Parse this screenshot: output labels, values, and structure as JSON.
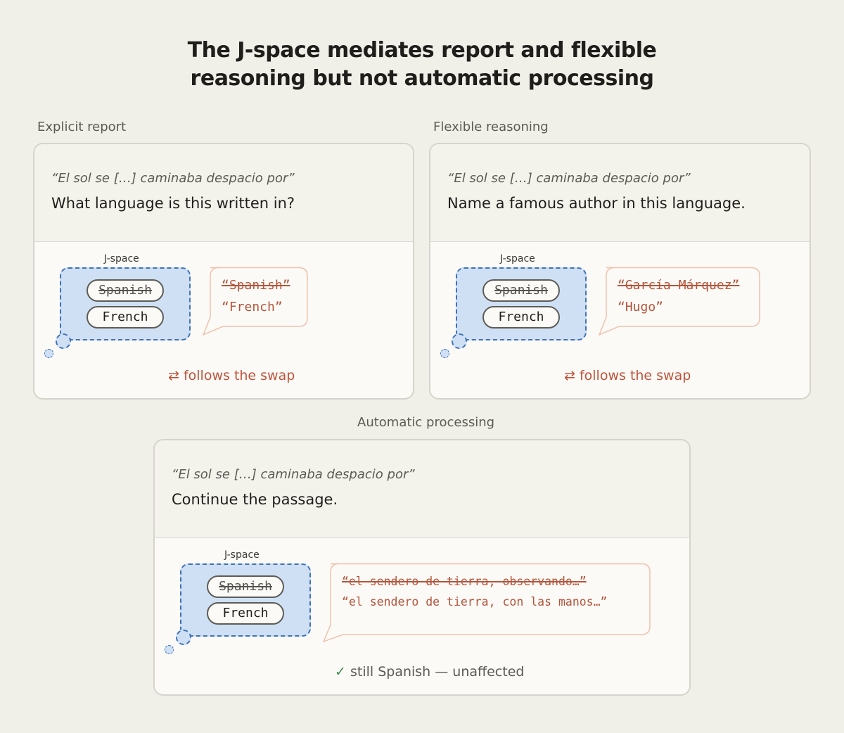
{
  "title": {
    "line1": "The J-space mediates report and flexible",
    "line2": "reasoning but not automatic processing"
  },
  "colors": {
    "background": "#f0efe8",
    "jspace_fill": "#cfe0f4",
    "jspace_border": "#3f72b8",
    "output_text": "#b5543a",
    "check": "#3f8a4a"
  },
  "panels": [
    {
      "label": "Explicit report",
      "quote": "“El sol se […] caminaba despacio por”",
      "question": "What language is this written in?",
      "jspace_label": "J-space",
      "pill_struck": "Spanish",
      "pill_active": "French",
      "output_struck": "“Spanish”",
      "output_active": "“French”",
      "note_icon": "⇄",
      "note_text": "follows the swap"
    },
    {
      "label": "Flexible reasoning",
      "quote": "“El sol se […] caminaba despacio por”",
      "question": "Name a famous author in this language.",
      "jspace_label": "J-space",
      "pill_struck": "Spanish",
      "pill_active": "French",
      "output_struck": "“García Márquez”",
      "output_active": "“Hugo”",
      "note_icon": "⇄",
      "note_text": "follows the swap"
    },
    {
      "label": "Automatic processing",
      "quote": "“El sol se […] caminaba despacio por”",
      "question": "Continue the passage.",
      "jspace_label": "J-space",
      "pill_struck": "Spanish",
      "pill_active": "French",
      "output_struck": "“el sendero de tierra, observando…”",
      "output_active": "“el sendero de tierra, con las manos…”",
      "note_icon": "✓",
      "note_text": "still Spanish — unaffected"
    }
  ]
}
